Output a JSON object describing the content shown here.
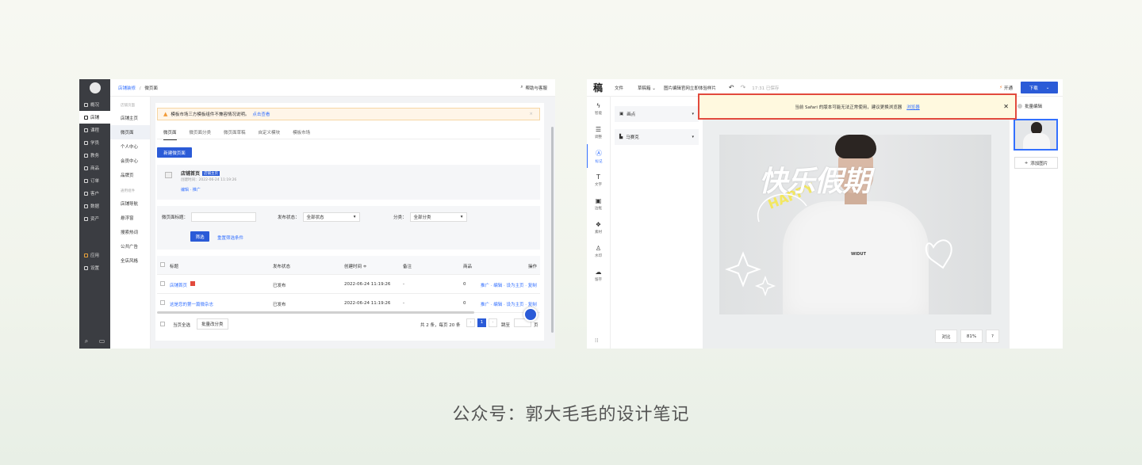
{
  "caption": "公众号：郭大毛毛的设计笔记",
  "left": {
    "dark_nav": [
      "概况",
      "店铺",
      "课程",
      "学员",
      "教务",
      "商品",
      "订单",
      "客户",
      "数据",
      "资产",
      "应用",
      "设置"
    ],
    "breadcrumb": {
      "parent": "店铺装修",
      "sep": "/",
      "current": "微页面"
    },
    "help": "帮助与客服",
    "sub_groups": [
      {
        "title": "店铺页面",
        "items": [
          "店铺主页",
          "微页面",
          "个人中心",
          "会员中心",
          "品牌页"
        ]
      },
      {
        "title": "通用组件",
        "items": [
          "店铺导航",
          "悬浮窗",
          "搜索热词",
          "公共广告",
          "全店风格"
        ]
      }
    ],
    "warning": {
      "text": "模板市场三方模板组件不兼容情况说明。",
      "link": "点击查看"
    },
    "tabs": [
      "微页面",
      "微页面分类",
      "微页面草稿",
      "自定义模块",
      "模板市场"
    ],
    "new_button": "新建微页面",
    "home_card": {
      "title": "店铺首页",
      "badge": "店铺主页",
      "created": "创建时间：2022-06-24 11:19:26",
      "actions": "编辑 · 推广"
    },
    "filter": {
      "title_label": "微页面标题：",
      "status_label": "发布状态：",
      "status_value": "全部状态",
      "category_label": "分类：",
      "category_value": "全部分类",
      "filter_button": "筛选",
      "reset_link": "重置筛选条件"
    },
    "table": {
      "headers": [
        "标题",
        "发布状态",
        "创建时间 ≑",
        "备注",
        "商品",
        "操作"
      ],
      "rows": [
        {
          "title": "店铺首页",
          "status": "已发布",
          "time": "2022-06-24 11:19:26",
          "note": "-",
          "goods": "0",
          "ops": "推广 · 编辑 · 设为主页 · 复制"
        },
        {
          "title": "这是您的第一篇微杂志",
          "status": "已发布",
          "time": "2022-06-24 11:19:26",
          "note": "-",
          "goods": "0",
          "ops": "推广 · 编辑 · 设为主页 · 复制"
        }
      ]
    },
    "footer": {
      "select_all": "当页全选",
      "batch": "批量改分类",
      "summary": "共 2 条，每页 20 条",
      "page": "1",
      "jump": "跳至",
      "page_suffix": "页"
    }
  },
  "right": {
    "logo": "稿",
    "menu": [
      "文件",
      "草稿箱 ⌄",
      "图片编辑官网立即体验样片"
    ],
    "saved": "17:31 已保存",
    "open": "开通",
    "download": "下载",
    "tools": [
      "智能",
      "调整",
      "标记",
      "文字",
      "边框",
      "素材",
      "水印",
      "留存"
    ],
    "panel_items": [
      "画点",
      "马赛克"
    ],
    "banner": {
      "text": "当前 Safari 的版本可能无法正常使用，建议更换浏览器",
      "link": "浏览器"
    },
    "poster_title": "快乐假期",
    "poster_happy": "HAPPY",
    "shirt_logo": "WIDUT",
    "zoom": {
      "compare": "对比",
      "level": "81%",
      "help": "?"
    },
    "batch_edit": "批量编辑",
    "add_image": "添加图片"
  }
}
